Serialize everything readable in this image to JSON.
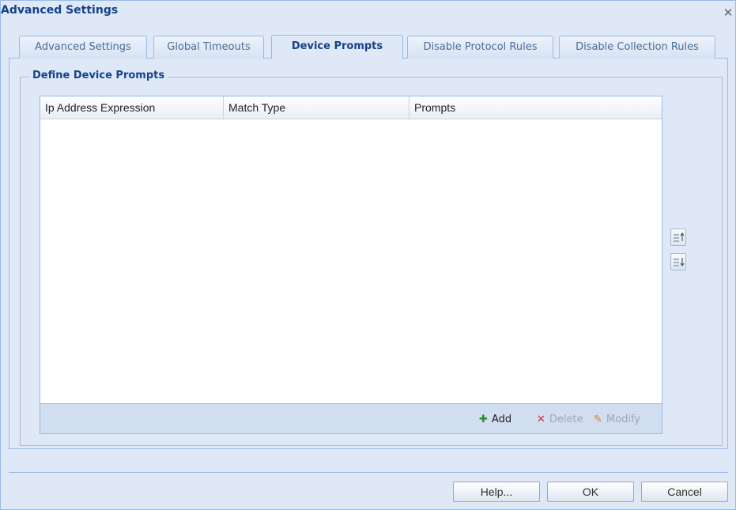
{
  "window": {
    "title": "Advanced Settings",
    "close_glyph": "✕"
  },
  "tabs": [
    {
      "label": "Advanced Settings",
      "active": false
    },
    {
      "label": "Global Timeouts",
      "active": false
    },
    {
      "label": "Device Prompts",
      "active": true
    },
    {
      "label": "Disable Protocol Rules",
      "active": false
    },
    {
      "label": "Disable Collection Rules",
      "active": false
    }
  ],
  "fieldset": {
    "legend": "Define Device Prompts"
  },
  "grid": {
    "columns": [
      "Ip Address Expression",
      "Match Type",
      "Prompts"
    ],
    "rows": []
  },
  "grid_toolbar": {
    "add": {
      "label": "Add",
      "icon": "plus-icon",
      "glyph": "✚",
      "color": "#2e8b2e",
      "enabled": true
    },
    "delete": {
      "label": "Delete",
      "icon": "x-icon",
      "glyph": "✕",
      "color": "#cc3333",
      "enabled": false
    },
    "modify": {
      "label": "Modify",
      "icon": "pencil-icon",
      "glyph": "✎",
      "color": "#c58a1a",
      "enabled": false
    }
  },
  "side_buttons": [
    {
      "icon": "move-up-icon"
    },
    {
      "icon": "move-down-icon"
    }
  ],
  "footer": {
    "help": "Help...",
    "ok": "OK",
    "cancel": "Cancel"
  },
  "colors": {
    "title": "#15428b",
    "panel": "#dfe8f6",
    "border": "#99bbe8",
    "disabled_text": "#a0a8b4"
  }
}
